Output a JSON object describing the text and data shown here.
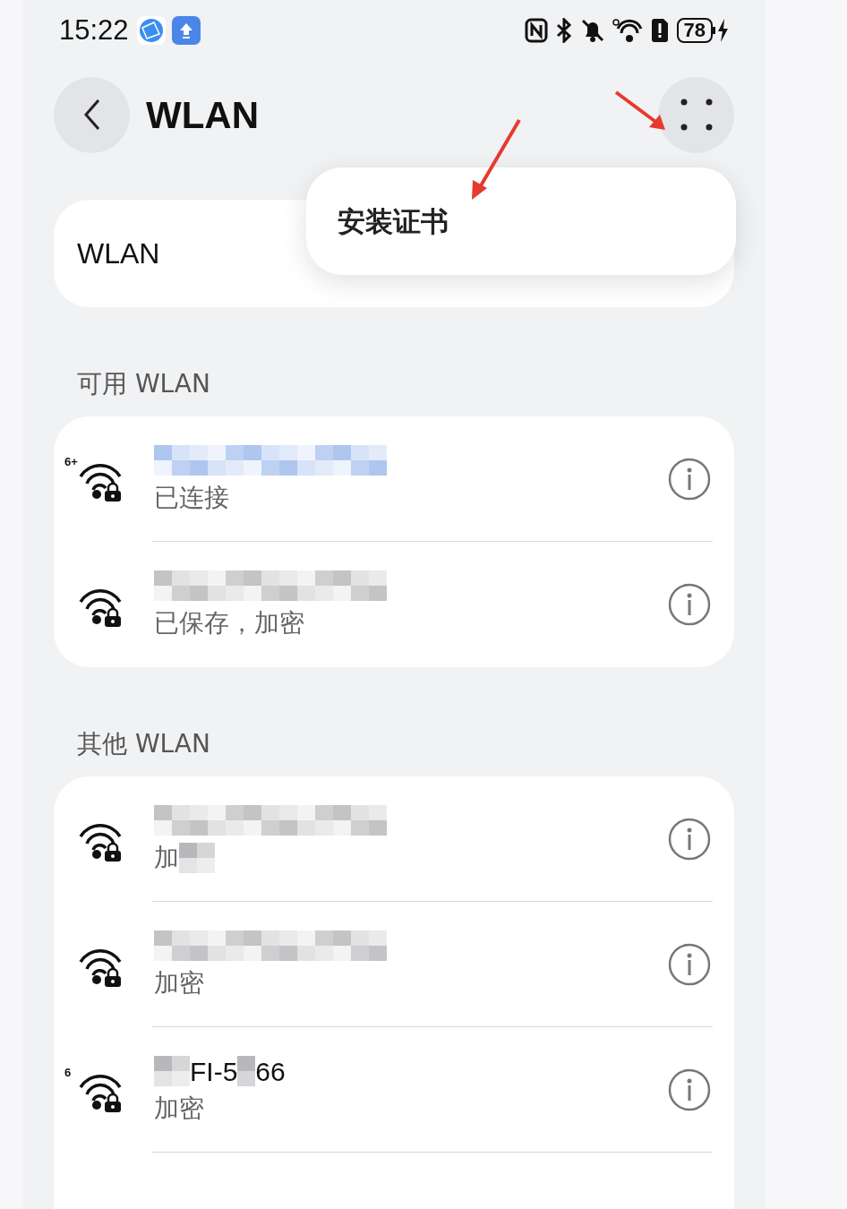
{
  "status_bar": {
    "time": "15:22",
    "battery": "78",
    "charging": true
  },
  "header": {
    "title": "WLAN"
  },
  "wlan_toggle": {
    "label": "WLAN"
  },
  "menu": {
    "items": [
      "安装证书"
    ]
  },
  "sections": [
    {
      "title": "可用 WLAN",
      "networks": [
        {
          "band_label": "6+",
          "color": "#aec6f0",
          "status": "已连接"
        },
        {
          "color": "#c4c4c6",
          "status": "已保存，加密"
        }
      ]
    },
    {
      "title": "其他 WLAN",
      "networks": [
        {
          "color": "#c4c4c6",
          "status": "加",
          "status_masked": true
        },
        {
          "color": "#c4c4c6",
          "status": "加密"
        },
        {
          "band_label": "6",
          "name_parts": [
            "FI-5",
            "66"
          ],
          "status": "加密"
        }
      ]
    }
  ]
}
